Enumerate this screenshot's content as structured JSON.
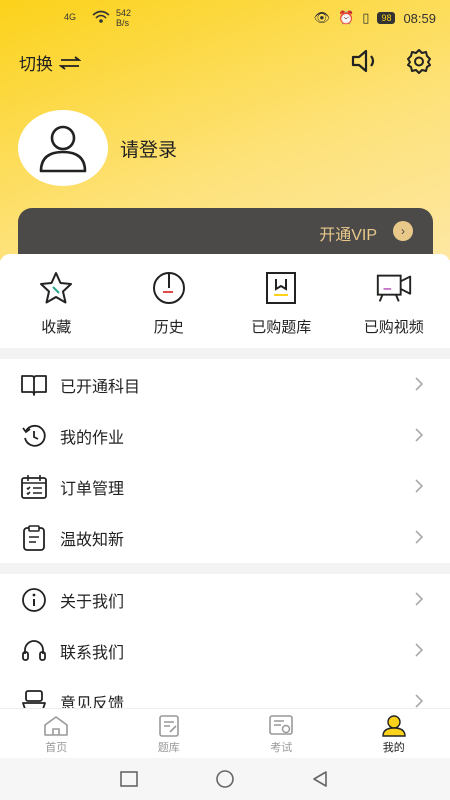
{
  "status_bar": {
    "signal": "4G",
    "speed_value": "542",
    "speed_unit": "B/s",
    "battery": "98",
    "time": "08:59"
  },
  "header": {
    "switch_label": "切换"
  },
  "profile": {
    "login_label": "请登录"
  },
  "vip": {
    "label": "开通VIP"
  },
  "quick_actions": [
    {
      "label": "收藏",
      "icon": "star-icon"
    },
    {
      "label": "历史",
      "icon": "history-clock-icon"
    },
    {
      "label": "已购题库",
      "icon": "question-bank-icon"
    },
    {
      "label": "已购视频",
      "icon": "video-camera-icon"
    }
  ],
  "menu_group_1": [
    {
      "label": "已开通科目",
      "icon": "book-icon"
    },
    {
      "label": "我的作业",
      "icon": "history-icon"
    },
    {
      "label": "订单管理",
      "icon": "calendar-list-icon"
    },
    {
      "label": "温故知新",
      "icon": "clipboard-icon"
    }
  ],
  "menu_group_2": [
    {
      "label": "关于我们",
      "icon": "info-icon"
    },
    {
      "label": "联系我们",
      "icon": "headset-icon"
    },
    {
      "label": "意见反馈",
      "icon": "feedback-icon"
    }
  ],
  "tabs": [
    {
      "label": "首页",
      "icon": "home-icon"
    },
    {
      "label": "题库",
      "icon": "question-bank-icon"
    },
    {
      "label": "考试",
      "icon": "exam-icon"
    },
    {
      "label": "我的",
      "icon": "user-icon",
      "active": true
    }
  ],
  "colors": {
    "accent": "#fcd21a",
    "vip_bg": "#4b4a49",
    "vip_text": "#e9c98a"
  }
}
